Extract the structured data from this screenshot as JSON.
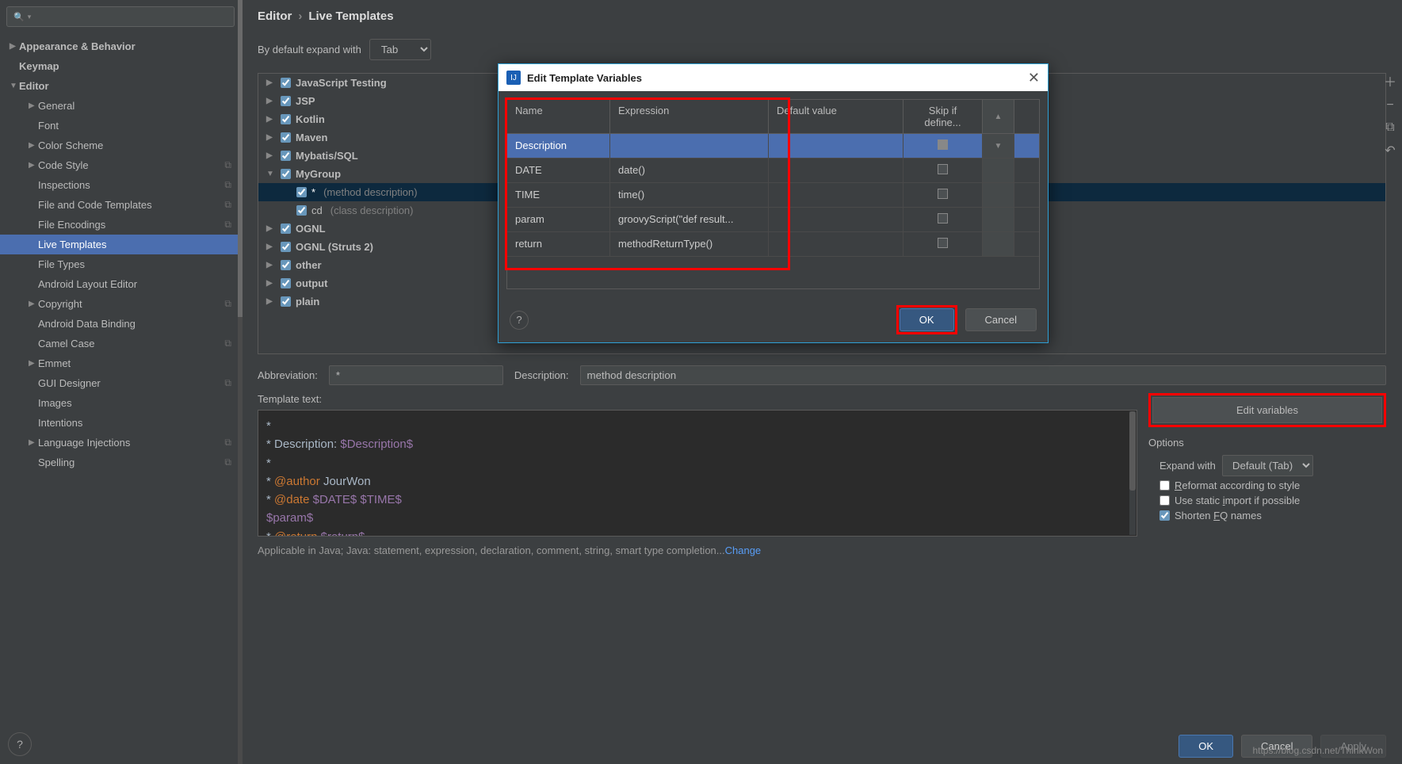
{
  "breadcrumb": {
    "parent": "Editor",
    "current": "Live Templates"
  },
  "search": {
    "placeholder": ""
  },
  "expand": {
    "label": "By default expand with",
    "value": "Tab"
  },
  "sidebar": {
    "items": [
      {
        "label": "Appearance & Behavior",
        "level": 1,
        "arrow": "▶"
      },
      {
        "label": "Keymap",
        "level": 1,
        "arrow": ""
      },
      {
        "label": "Editor",
        "level": 1,
        "arrow": "▼"
      },
      {
        "label": "General",
        "level": 2,
        "arrow": "▶"
      },
      {
        "label": "Font",
        "level": 2,
        "arrow": ""
      },
      {
        "label": "Color Scheme",
        "level": 2,
        "arrow": "▶"
      },
      {
        "label": "Code Style",
        "level": 2,
        "arrow": "▶",
        "copy": true
      },
      {
        "label": "Inspections",
        "level": 2,
        "arrow": "",
        "copy": true
      },
      {
        "label": "File and Code Templates",
        "level": 2,
        "arrow": "",
        "copy": true
      },
      {
        "label": "File Encodings",
        "level": 2,
        "arrow": "",
        "copy": true
      },
      {
        "label": "Live Templates",
        "level": 2,
        "arrow": "",
        "selected": true
      },
      {
        "label": "File Types",
        "level": 2,
        "arrow": ""
      },
      {
        "label": "Android Layout Editor",
        "level": 2,
        "arrow": ""
      },
      {
        "label": "Copyright",
        "level": 2,
        "arrow": "▶",
        "copy": true
      },
      {
        "label": "Android Data Binding",
        "level": 2,
        "arrow": ""
      },
      {
        "label": "Camel Case",
        "level": 2,
        "arrow": "",
        "copy": true
      },
      {
        "label": "Emmet",
        "level": 2,
        "arrow": "▶"
      },
      {
        "label": "GUI Designer",
        "level": 2,
        "arrow": "",
        "copy": true
      },
      {
        "label": "Images",
        "level": 2,
        "arrow": ""
      },
      {
        "label": "Intentions",
        "level": 2,
        "arrow": ""
      },
      {
        "label": "Language Injections",
        "level": 2,
        "arrow": "▶",
        "copy": true
      },
      {
        "label": "Spelling",
        "level": 2,
        "arrow": "",
        "copy": true
      }
    ]
  },
  "templates": [
    {
      "label": "JavaScript Testing",
      "arrow": "▶",
      "bold": true
    },
    {
      "label": "JSP",
      "arrow": "▶",
      "bold": true
    },
    {
      "label": "Kotlin",
      "arrow": "▶",
      "bold": true
    },
    {
      "label": "Maven",
      "arrow": "▶",
      "bold": true
    },
    {
      "label": "Mybatis/SQL",
      "arrow": "▶",
      "bold": true
    },
    {
      "label": "MyGroup",
      "arrow": "▼",
      "bold": true
    },
    {
      "label": "*",
      "desc": "(method description)",
      "level": 2,
      "selected": true
    },
    {
      "label": "cd",
      "desc": "(class description)",
      "level": 2
    },
    {
      "label": "OGNL",
      "arrow": "▶",
      "bold": true
    },
    {
      "label": "OGNL (Struts 2)",
      "arrow": "▶",
      "bold": true
    },
    {
      "label": "other",
      "arrow": "▶",
      "bold": true
    },
    {
      "label": "output",
      "arrow": "▶",
      "bold": true
    },
    {
      "label": "plain",
      "arrow": "▶",
      "bold": true
    }
  ],
  "form": {
    "abbrev_label": "Abbreviation:",
    "abbrev_value": "*",
    "desc_label": "Description:",
    "desc_value": "method description",
    "template_label": "Template text:",
    "edit_vars": "Edit variables",
    "options_title": "Options",
    "expand_with_label": "Expand with",
    "expand_with_value": "Default (Tab)",
    "reformat": "Reformat according to style",
    "static_import": "Use static import if possible",
    "shorten_fq": "Shorten FQ names"
  },
  "template_text": {
    "l1": "*",
    "l2_a": " * Description: ",
    "l2_b": "$Description$",
    "l3": " *",
    "l4_a": " * ",
    "l4_b": "@author",
    "l4_c": " JourWon",
    "l5_a": " * ",
    "l5_b": "@date",
    "l5_c": " ",
    "l5_d": "$DATE$",
    "l5_e": " ",
    "l5_f": "$TIME$",
    "l6": "$param$",
    "l7_a": " * ",
    "l7_b": "@return",
    "l7_c": " ",
    "l7_d": "$return$"
  },
  "applicable": {
    "text": "Applicable in Java; Java: statement, expression, declaration, comment, string, smart type completion...",
    "link": "Change"
  },
  "dialog": {
    "title": "Edit Template Variables",
    "cols": {
      "name": "Name",
      "expr": "Expression",
      "defv": "Default value",
      "skip": "Skip if define..."
    },
    "rows": [
      {
        "name": "Description",
        "expr": "",
        "defv": "",
        "skip": "on",
        "selected": true
      },
      {
        "name": "DATE",
        "expr": "date()",
        "defv": "",
        "skip": ""
      },
      {
        "name": "TIME",
        "expr": "time()",
        "defv": "",
        "skip": ""
      },
      {
        "name": "param",
        "expr": "groovyScript(\"def result...",
        "defv": "",
        "skip": ""
      },
      {
        "name": "return",
        "expr": "methodReturnType()",
        "defv": "",
        "skip": ""
      }
    ],
    "ok": "OK",
    "cancel": "Cancel"
  },
  "bottom": {
    "ok": "OK",
    "cancel": "Cancel",
    "apply": "Apply"
  },
  "watermark": "https://blog.csdn.net/ThinkWon"
}
